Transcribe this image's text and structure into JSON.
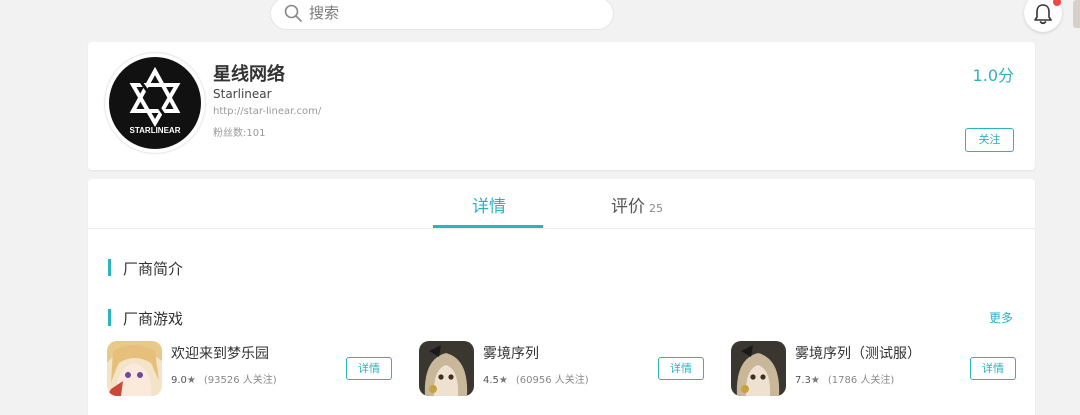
{
  "search": {
    "placeholder": "搜索"
  },
  "vendor": {
    "name": "星线网络",
    "name_en": "Starlinear",
    "url": "http://star-linear.com/",
    "fans": "粉丝数:101",
    "score": "1.0分",
    "follow_label": "关注",
    "logo_text": "STARLINEAR"
  },
  "tabs": [
    {
      "label": "详情"
    },
    {
      "label": "评价",
      "count": "25"
    }
  ],
  "sections": {
    "intro_title": "厂商简介",
    "games_title": "厂商游戏",
    "more_label": "更多"
  },
  "games": [
    {
      "name": "欢迎来到梦乐园",
      "rating": "9.0",
      "star": "★",
      "fans": "(93526 人关注)",
      "detail_label": "详情"
    },
    {
      "name": "雾境序列",
      "rating": "4.5",
      "star": "★",
      "fans": "(60956 人关注)",
      "detail_label": "详情"
    },
    {
      "name": "雾境序列（测试服）",
      "rating": "7.3",
      "star": "★",
      "fans": "(1786 人关注)",
      "detail_label": "详情"
    }
  ],
  "colors": {
    "accent": "#2bb3c0",
    "notification": "#f04848",
    "background": "#f2f2f2"
  },
  "icons": {
    "search": "search-icon",
    "bell": "bell-icon"
  }
}
